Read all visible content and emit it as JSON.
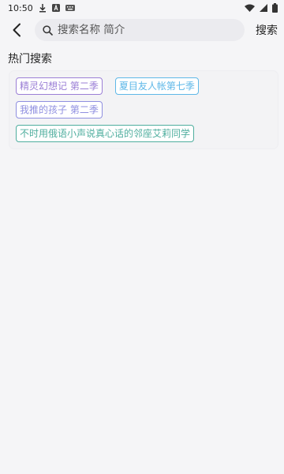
{
  "status_bar": {
    "time": "10:50",
    "icons": [
      "download-icon",
      "a-box-icon",
      "keyboard-icon",
      "wifi-icon",
      "signal-icon",
      "battery-icon"
    ]
  },
  "header": {
    "search_placeholder": "搜索名称 简介",
    "search_value": "",
    "search_button": "搜索"
  },
  "hot_search": {
    "title": "热门搜索",
    "tags": [
      {
        "label": "精灵幻想记 第二季",
        "color": "#9b7fd6"
      },
      {
        "label": "夏目友人帐第七季",
        "color": "#5fb8e8"
      },
      {
        "label": "我推的孩子 第二季",
        "color": "#8f8fe0"
      },
      {
        "label": "不时用俄语小声说真心话的邻座艾莉同学",
        "color": "#4fae9e"
      }
    ]
  }
}
